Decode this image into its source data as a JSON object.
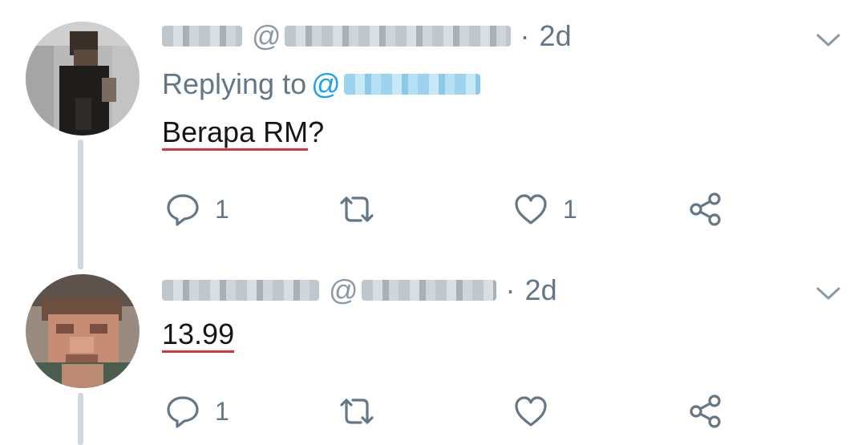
{
  "tweets": [
    {
      "display_name": "",
      "handle_prefix": "@",
      "separator": "·",
      "timestamp": "2d",
      "replying_label": "Replying to",
      "replying_prefix": "@",
      "text": "Berapa RM",
      "text_suffix": "?",
      "reply_count": "1",
      "retweet_count": "",
      "like_count": "1"
    },
    {
      "display_name": "",
      "handle_prefix": "@",
      "separator": "·",
      "timestamp": "2d",
      "text": "13.99",
      "text_suffix": "",
      "reply_count": "1",
      "retweet_count": "",
      "like_count": ""
    }
  ],
  "colors": {
    "meta_gray": "#657786",
    "link_blue": "#1da1f2",
    "thread_line": "#cfd9de",
    "spellcheck_red": "#d13a3a"
  },
  "icons": {
    "reply": "reply-icon",
    "retweet": "retweet-icon",
    "like": "heart-icon",
    "share": "share-icon",
    "menu": "chevron-down-icon"
  }
}
